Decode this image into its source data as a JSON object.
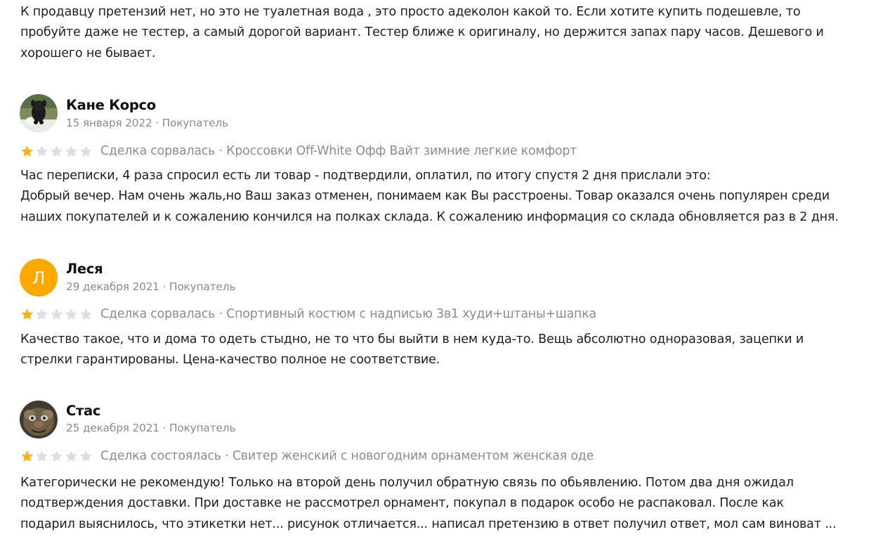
{
  "reviews": [
    {
      "text": "К продавцу претензий нет, но это не туалетная вода , это просто адеколон какой то. Если хотите купить подешевле, то\nпробуйте даже не тестер, а самый дорогой вариант. Тестер ближе к оригиналу, но держится запах пару часов. Дешевого и\nхорошего не бывает."
    },
    {
      "author": "Кане Корсо",
      "date": "15 января 2022",
      "role": "Покупатель",
      "meta": "15 января 2022 · Покупатель",
      "rating": 1,
      "deal_line": "Сделка сорвалась · Кроссовки Off-White Офф Вайт зимние легкие комфорт",
      "text": "Час переписки, 4 раза спросил есть ли товар - подтвердили, оплатил, по итогу спустя 2 дня прислали это:\nДобрый вечер. Нам очень жаль,но Ваш заказ отменен, понимаем как Вы расстроены. Товар оказался очень популярен среди\nнаших покупателей и к сожалению кончился на полках склада. К сожалению информация со склада обновляется раз в 2 дня."
    },
    {
      "author": "Леся",
      "avatar_letter": "Л",
      "date": "29 декабря 2021",
      "role": "Покупатель",
      "meta": "29 декабря 2021 · Покупатель",
      "rating": 1,
      "deal_line": "Сделка сорвалась · Спортивный костюм с надписью 3в1 худи+штаны+шапка",
      "text": "Качество такое, что и дома то одеть стыдно, не то что бы выйти в нем куда-то. Вещь абсолютно одноразовая, зацепки и\nстрелки гарантированы. Цена-качество полное не соответствие."
    },
    {
      "author": "Стас",
      "date": "25 декабря 2021",
      "role": "Покупатель",
      "meta": "25 декабря 2021 · Покупатель",
      "rating": 1,
      "deal_line": "Сделка состоялась · Свитер женский с новогодним орнаментом женская оде",
      "text": "Категорически не рекомендую! Только на второй день получил обратную связь по обьявлению. Потом два дня ожидал\nподтверждения доставки. При доставке не рассмотрел орнамент, покупал в подарок особо не распаковал. После как\nподарил выяснилось, что этикетки нет... рисунок отличается... написал претензию в ответ получил ответ, мол сам виноват ..."
    }
  ],
  "colors": {
    "star_filled": "#ffb21e",
    "star_empty": "#dedede",
    "avatar_letter_bg": "#ffa800",
    "meta_text": "#8c8c8c"
  },
  "icons": {
    "star": "star-icon",
    "avatar_dog": "dog-photo-avatar",
    "avatar_character": "cartoon-character-avatar"
  }
}
